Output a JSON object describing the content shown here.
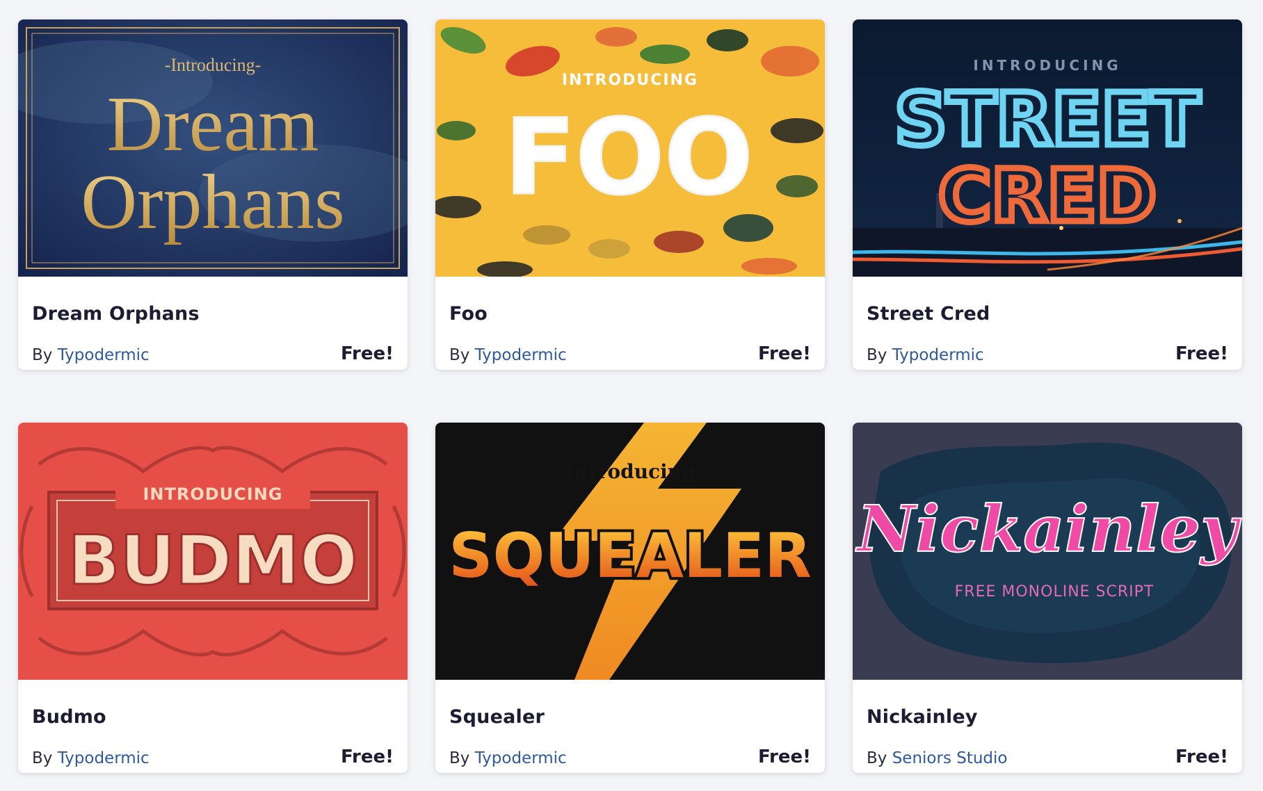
{
  "fonts": [
    {
      "title": "Dream Orphans",
      "by_label": "By",
      "author": "Typodermic",
      "price": "Free!",
      "preview": {
        "line1": "-Introducing-",
        "line2": "Dream",
        "line3": "Orphans",
        "bg": "#1b2d5c",
        "accent": "#d4b068"
      }
    },
    {
      "title": "Foo",
      "by_label": "By",
      "author": "Typodermic",
      "price": "Free!",
      "preview": {
        "line1": "INTRODUCING",
        "line2": "FOO",
        "bg": "#f6bd3b",
        "accent": "#ffffff"
      }
    },
    {
      "title": "Street Cred",
      "by_label": "By",
      "author": "Typodermic",
      "price": "Free!",
      "preview": {
        "line1": "INTRODUCING",
        "line2": "STREET",
        "line3": "CRED",
        "bg": "#0c1c33",
        "accent": "#6fd3f2",
        "accent2": "#ef6a3a"
      }
    },
    {
      "title": "Budmo",
      "by_label": "By",
      "author": "Typodermic",
      "price": "Free!",
      "preview": {
        "line1": "INTRODUCING",
        "line2": "BUDMO",
        "bg": "#e54f48",
        "accent": "#f7dcc2"
      }
    },
    {
      "title": "Squealer",
      "by_label": "By",
      "author": "Typodermic",
      "price": "Free!",
      "preview": {
        "line1": "Introducing",
        "line2": "SQUEALER",
        "bg": "#111111",
        "accent": "#f6a12c"
      }
    },
    {
      "title": "Nickainley",
      "by_label": "By",
      "author": "Seniors Studio",
      "price": "Free!",
      "preview": {
        "line1": "Nickainley",
        "line2": "FREE MONOLINE SCRIPT",
        "bg": "#3a3d52",
        "accent": "#ee4aa6"
      }
    }
  ]
}
